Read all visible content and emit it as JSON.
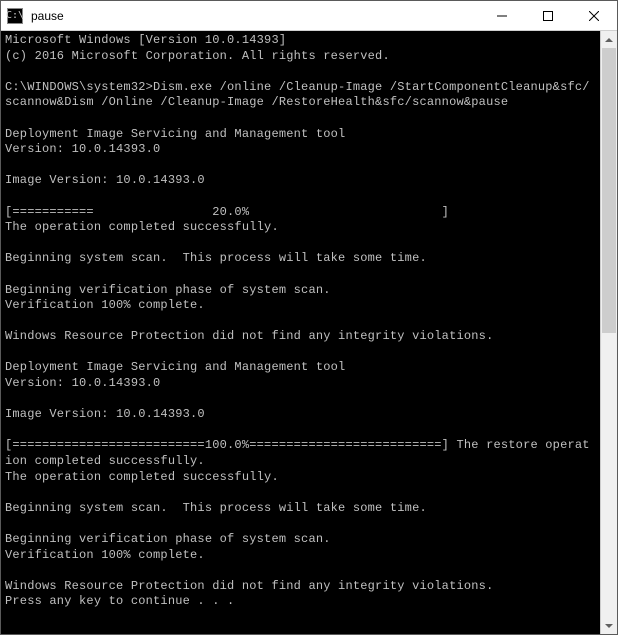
{
  "window": {
    "icon_text": "C:\\",
    "title": "pause"
  },
  "console": {
    "lines": "Microsoft Windows [Version 10.0.14393]\n(c) 2016 Microsoft Corporation. All rights reserved.\n\nC:\\WINDOWS\\system32>Dism.exe /online /Cleanup-Image /StartComponentCleanup&sfc/scannow&Dism /Online /Cleanup-Image /RestoreHealth&sfc/scannow&pause\n\nDeployment Image Servicing and Management tool\nVersion: 10.0.14393.0\n\nImage Version: 10.0.14393.0\n\n[===========                20.0%                          ]\nThe operation completed successfully.\n\nBeginning system scan.  This process will take some time.\n\nBeginning verification phase of system scan.\nVerification 100% complete.\n\nWindows Resource Protection did not find any integrity violations.\n\nDeployment Image Servicing and Management tool\nVersion: 10.0.14393.0\n\nImage Version: 10.0.14393.0\n\n[==========================100.0%==========================] The restore operation completed successfully.\nThe operation completed successfully.\n\nBeginning system scan.  This process will take some time.\n\nBeginning verification phase of system scan.\nVerification 100% complete.\n\nWindows Resource Protection did not find any integrity violations.\nPress any key to continue . . ."
  }
}
